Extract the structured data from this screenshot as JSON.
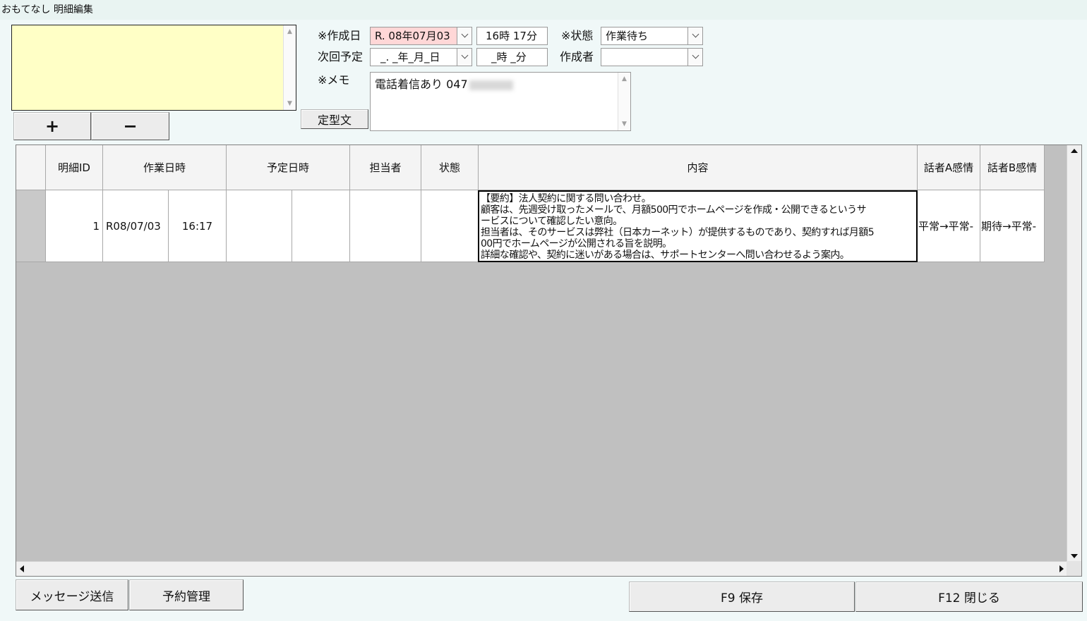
{
  "window": {
    "title": "おもてなし 明細編集"
  },
  "list_controls": {
    "add_label": "+",
    "remove_label": "−"
  },
  "form": {
    "created_date_label": "※作成日",
    "created_date_value": "R. 08年07月03",
    "created_time_value": "16時 17分",
    "status_label": "※状態",
    "status_value": "作業待ち",
    "next_schedule_label": "次回予定",
    "next_date_value": "_. _年_月_日",
    "next_time_value": "_時 _分",
    "author_label": "作成者",
    "author_value": "",
    "memo_label": "※メモ",
    "memo_value": "電話着信あり 047",
    "template_button_label": "定型文"
  },
  "table": {
    "headers": {
      "detail_id": "明細ID",
      "work_datetime": "作業日時",
      "scheduled_datetime": "予定日時",
      "assignee": "担当者",
      "status": "状態",
      "content": "内容",
      "speaker_a": "話者A感情",
      "speaker_b": "話者B感情"
    },
    "rows": [
      {
        "detail_id": "1",
        "work_date": "R08/07/03",
        "work_time": "16:17",
        "scheduled_date": "",
        "scheduled_time": "",
        "assignee": "",
        "status": "",
        "content_lines": [
          "【要約】法人契約に関する問い合わせ。",
          "顧客は、先週受け取ったメールで、月額500円でホームページを作成・公開できるというサ",
          "ービスについて確認したい意向。",
          "担当者は、そのサービスは弊社（日本カーネット）が提供するものであり、契約すれば月額5",
          "00円でホームページが公開される旨を説明。",
          "詳細な確認や、契約に迷いがある場合は、サポートセンターへ問い合わせるよう案内。"
        ],
        "speaker_a": "平常→平常-",
        "speaker_b": "期待→平常-"
      }
    ]
  },
  "footer": {
    "send_message_label": "メッセージ送信",
    "reservation_label": "予約管理",
    "save_label": "F9 保存",
    "close_label": "F12 閉じる"
  }
}
